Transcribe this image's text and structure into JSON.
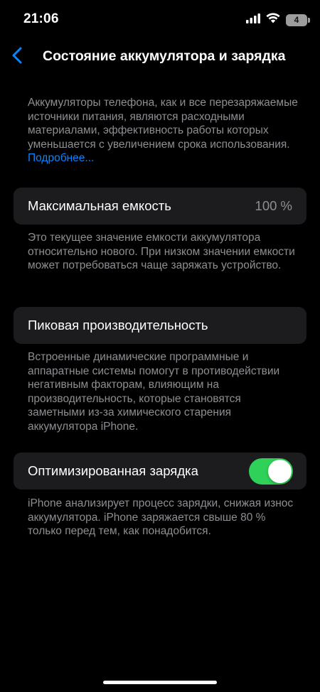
{
  "status_bar": {
    "time": "21:06",
    "battery_level": "4"
  },
  "nav": {
    "title": "Состояние аккумулятора и зарядка"
  },
  "intro": {
    "text": "Аккумуляторы телефона, как и все перезаряжаемые источники питания, являются расходными материалами, эффективность работы которых уменьшается с увеличением срока использования.",
    "link": "Подробнее..."
  },
  "max_capacity": {
    "label": "Максимальная емкость",
    "value": "100 %",
    "footer": "Это текущее значение емкости аккумулятора относительно нового. При низком значении емкости может потребоваться чаще заряжать устройство."
  },
  "peak_performance": {
    "label": "Пиковая производительность",
    "footer": "Встроенные динамические программные и аппаратные системы помогут в противодействии негативным факторам, влияющим на производительность, которые становятся заметными из-за химического старения аккумулятора iPhone."
  },
  "optimized_charging": {
    "label": "Оптимизированная зарядка",
    "enabled": true,
    "footer": "iPhone анализирует процесс зарядки, снижая износ аккумулятора. iPhone заряжается свыше 80 % только перед тем, как понадобится."
  },
  "colors": {
    "background": "#000000",
    "cell": "#1c1c1e",
    "secondary_text": "#8e8e93",
    "link": "#0a84ff",
    "toggle_on": "#30d158"
  },
  "icons": [
    "signal-icon",
    "wifi-icon",
    "battery-icon",
    "chevron-left-icon"
  ]
}
